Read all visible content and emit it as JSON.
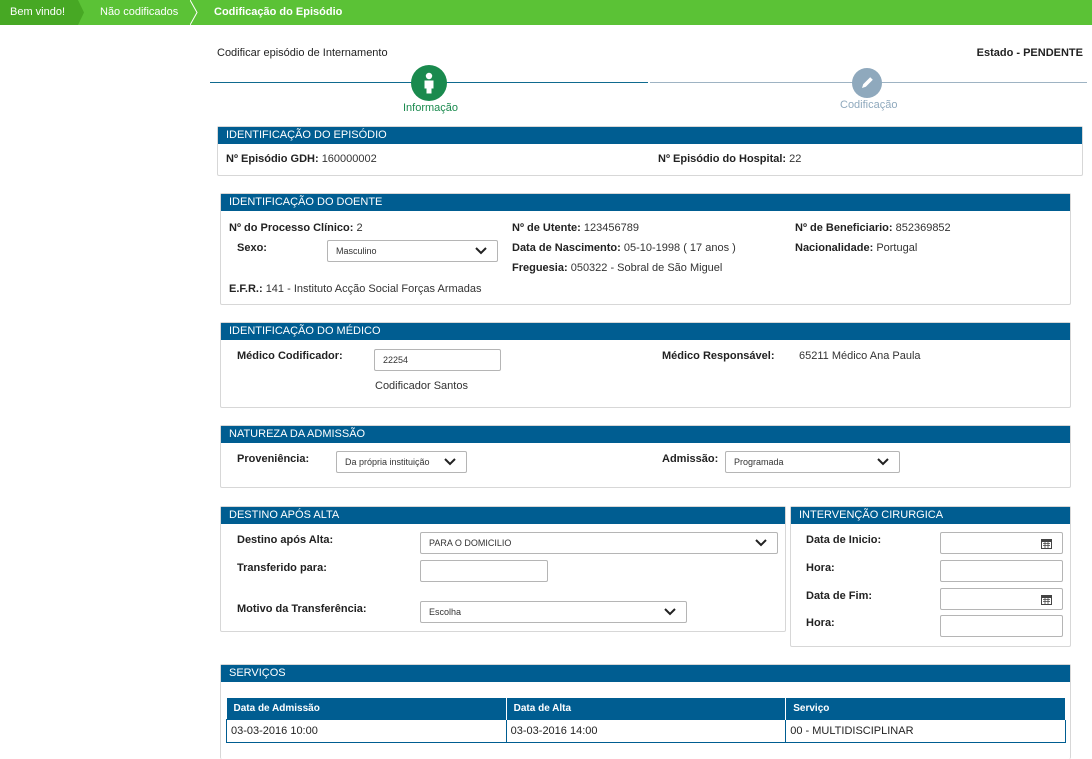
{
  "breadcrumbs": [
    "Bem vindo!",
    "Não codificados",
    "Codificação do Episódio"
  ],
  "header": {
    "title": "Codificar episódio de Internamento",
    "status": "Estado - PENDENTE"
  },
  "steps": [
    {
      "label": "Informação",
      "active": true,
      "icon": "person-icon"
    },
    {
      "label": "Codificação",
      "active": false,
      "icon": "pencil-icon"
    }
  ],
  "colors": {
    "green": "#5bc236",
    "darkgreen": "#47a824",
    "step_active": "#1a8a4e",
    "step_inactive": "#8fa9bd",
    "header_blue": "#005d91"
  },
  "episodio": {
    "title": "IDENTIFICAÇÃO DO EPISÓDIO",
    "gdh_label": "Nº Episódio GDH:",
    "gdh_value": "160000002",
    "hosp_label": "Nº Episódio do Hospital:",
    "hosp_value": "22"
  },
  "doente": {
    "title": "IDENTIFICAÇÃO DO DOENTE",
    "processo_label": "Nº do Processo Clínico:",
    "processo_value": "2",
    "utente_label": "Nº de Utente:",
    "utente_value": "123456789",
    "beneficiario_label": "Nº de Beneficiario:",
    "beneficiario_value": "852369852",
    "sexo_label": "Sexo:",
    "sexo_value": "Masculino",
    "nascimento_label": "Data de Nascimento:",
    "nascimento_value": "05-10-1998 ( 17 anos )",
    "nacionalidade_label": "Nacionalidade:",
    "nacionalidade_value": "Portugal",
    "freguesia_label": "Freguesia:",
    "freguesia_value": "050322 - Sobral de São Miguel",
    "efr_label": "E.F.R.:",
    "efr_value": "141 - Instituto Acção Social Forças Armadas"
  },
  "medico": {
    "title": "IDENTIFICAÇÃO DO MÉDICO",
    "codificador_label": "Médico Codificador:",
    "codificador_value": "22254",
    "codificador_name": "Codificador Santos",
    "responsavel_label": "Médico Responsável:",
    "responsavel_value": "65211 Médico Ana Paula"
  },
  "admissao": {
    "title": "NATUREZA DA ADMISSÃO",
    "proveniencia_label": "Proveniência:",
    "proveniencia_value": "Da própria instituição",
    "admissao_label": "Admissão:",
    "admissao_value": "Programada"
  },
  "destino": {
    "title": "DESTINO APÓS ALTA",
    "destino_label": "Destino após Alta:",
    "destino_value": "PARA O DOMICILIO",
    "transferido_label": "Transferido para:",
    "transferido_value": "",
    "motivo_label": "Motivo da Transferência:",
    "motivo_value": "Escolha"
  },
  "intervencao": {
    "title": "INTERVENÇÃO CIRURGICA",
    "inicio_label": "Data de Inicio:",
    "hora1_label": "Hora:",
    "fim_label": "Data de Fim:",
    "hora2_label": "Hora:"
  },
  "servicos": {
    "title": "SERVIÇOS",
    "columns": [
      "Data de Admissão",
      "Data de Alta",
      "Serviço"
    ],
    "rows": [
      [
        "03-03-2016 10:00",
        "03-03-2016 14:00",
        "00 - MULTIDISCIPLINAR"
      ]
    ]
  }
}
